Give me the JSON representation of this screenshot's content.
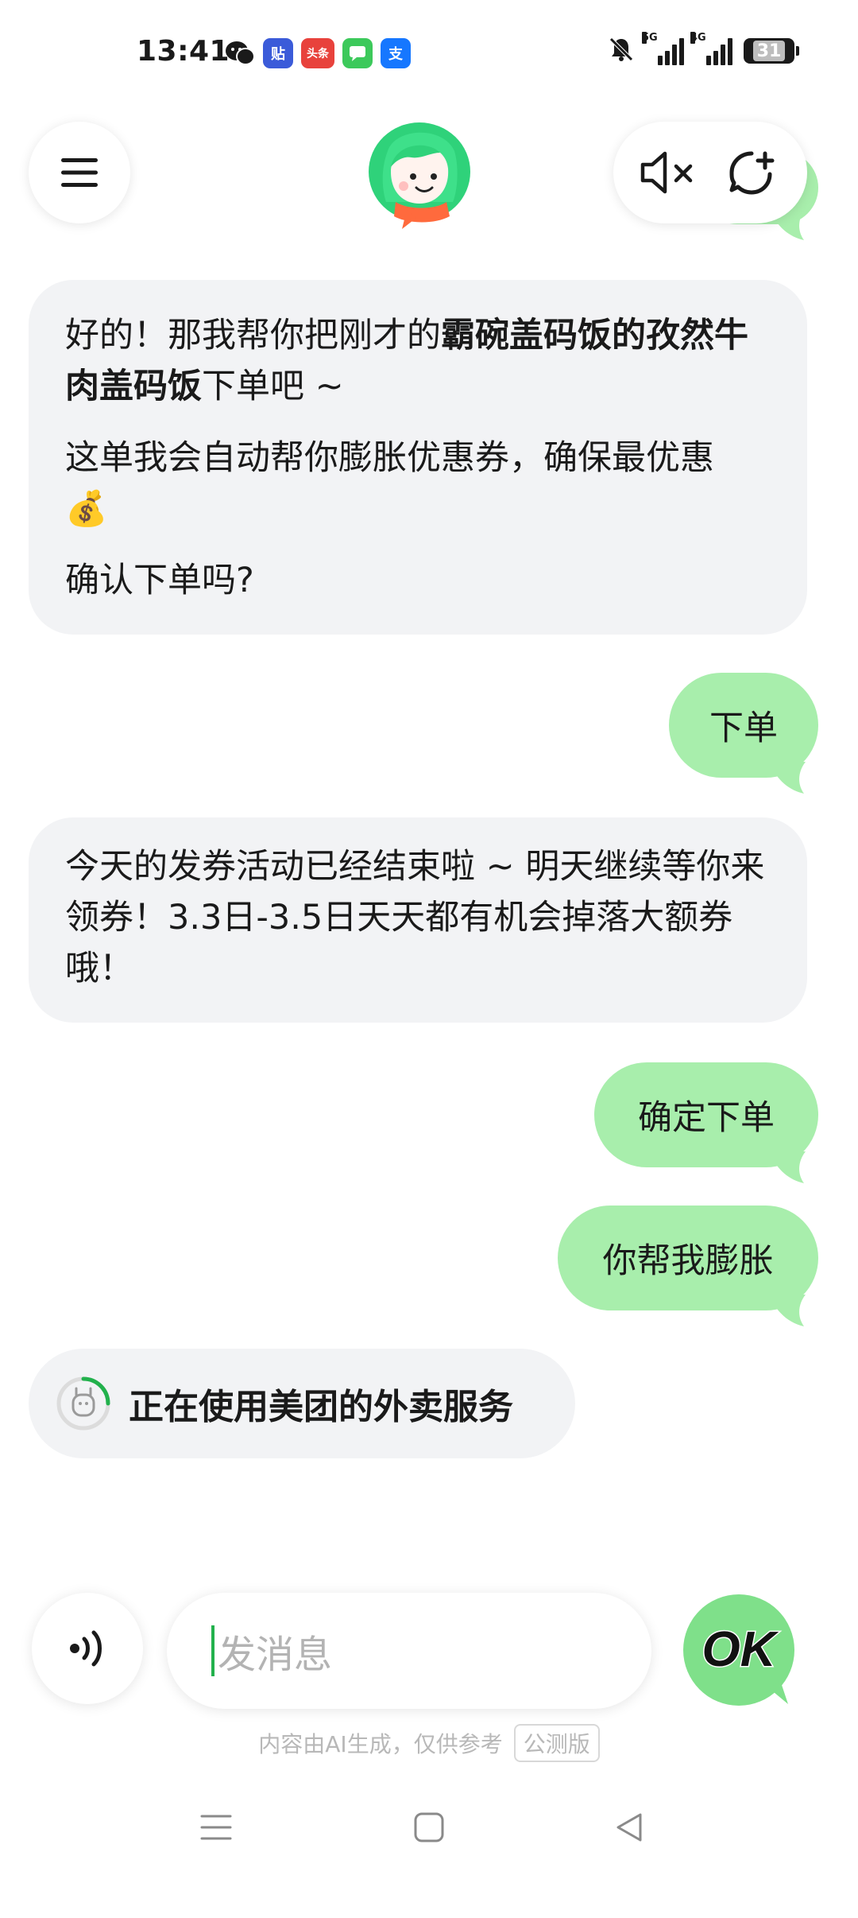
{
  "status_bar": {
    "time": "13:41",
    "apps": [
      {
        "name": "wechat-icon",
        "label": "",
        "color": "#1a1a1a"
      },
      {
        "name": "tieba-icon",
        "label": "贴",
        "color": "#3b5bd9"
      },
      {
        "name": "toutiao-icon",
        "label": "头条",
        "color": "#e8423c"
      },
      {
        "name": "messages-icon",
        "label": "",
        "color": "#3cc95b"
      },
      {
        "name": "alipay-icon",
        "label": "支",
        "color": "#1677ff"
      }
    ],
    "network_1": "5G",
    "network_2": "4G",
    "battery": "31"
  },
  "header": {
    "menu_icon": "hamburger-icon",
    "avatar_icon": "assistant-avatar-icon",
    "mute_icon": "speaker-muted-icon",
    "new_chat_icon": "new-chat-icon"
  },
  "messages": {
    "ai_1": {
      "line1_prefix": "好的！那我帮你把刚才的",
      "line1_bold": "霸碗盖码饭的孜然牛肉盖码饭",
      "line1_suffix": "下单吧 ~",
      "line2": "这单我会自动帮你膨胀优惠券，确保最优惠",
      "line2_emoji": "💰",
      "line3": "确认下单吗?"
    },
    "user_1": "下单",
    "ai_2": "今天的发券活动已经结束啦 ~ 明天继续等你来领券！3.3日-3.5日天天都有机会掉落大额券哦！",
    "user_2": "确定下单",
    "user_3": "你帮我膨胀",
    "service_status": "正在使用美团的外卖服务"
  },
  "input": {
    "placeholder": "发消息",
    "voice_icon": "voice-input-icon",
    "ok_label": "OK"
  },
  "footer": {
    "disclaimer": "内容由AI生成，仅供参考",
    "beta": "公测版"
  },
  "nav": {
    "menu_icon": "nav-menu-icon",
    "home_icon": "nav-home-icon",
    "back_icon": "nav-back-icon"
  },
  "colors": {
    "user_bubble": "#a8eeac",
    "ai_bubble": "#f2f3f5",
    "accent_green": "#22b14c"
  }
}
